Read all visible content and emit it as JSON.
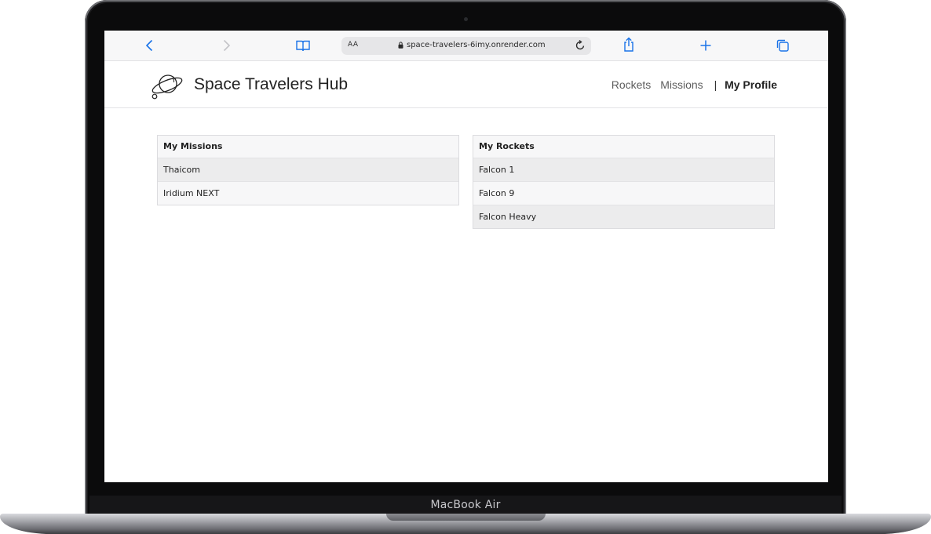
{
  "device": {
    "model_label": "MacBook Air"
  },
  "browser": {
    "address_prefix": "AA",
    "url": "space-travelers-6imy.onrender.com",
    "icons": [
      "chevron-left-icon",
      "chevron-right-icon",
      "book-icon",
      "lock-icon",
      "reload-icon",
      "share-icon",
      "plus-icon",
      "tabs-icon"
    ]
  },
  "app": {
    "title": "Space Travelers Hub",
    "nav": {
      "rockets": "Rockets",
      "missions": "Missions",
      "separator": "|",
      "profile": "My Profile"
    }
  },
  "profile": {
    "missions": {
      "header": "My Missions",
      "items": [
        "Thaicom",
        "Iridium NEXT"
      ]
    },
    "rockets": {
      "header": "My Rockets",
      "items": [
        "Falcon 1",
        "Falcon 9",
        "Falcon Heavy"
      ]
    }
  },
  "colors": {
    "accent": "#1a73e8",
    "row_alt": "#ececed",
    "row": "#f7f7f8"
  }
}
